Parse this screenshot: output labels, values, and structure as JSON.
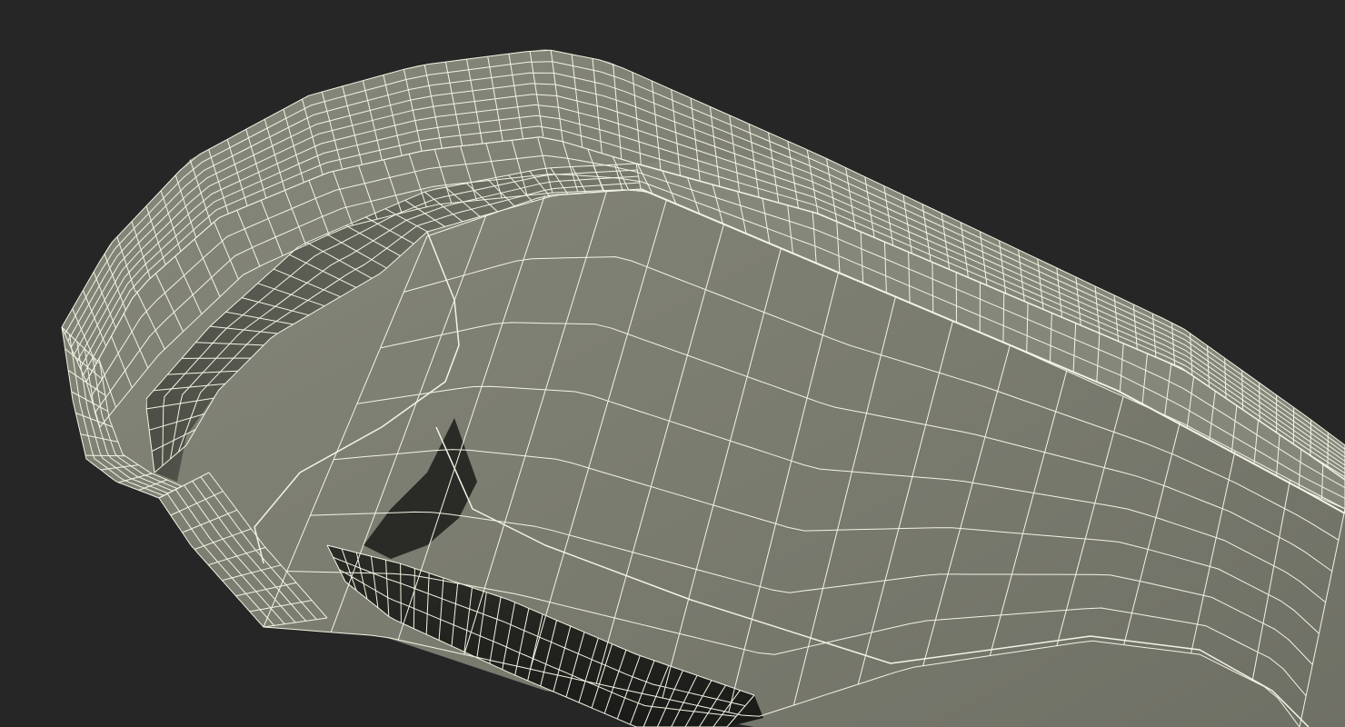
{
  "scene": {
    "subject": "wireframe-mesh-render",
    "colors": {
      "background": "#262626",
      "surface": "#7a7b6f",
      "surface_light": "#85877a",
      "surface_dark": "#5c5d54",
      "shadow": "#1e1f1b",
      "wire": "#f2f4e4"
    }
  }
}
